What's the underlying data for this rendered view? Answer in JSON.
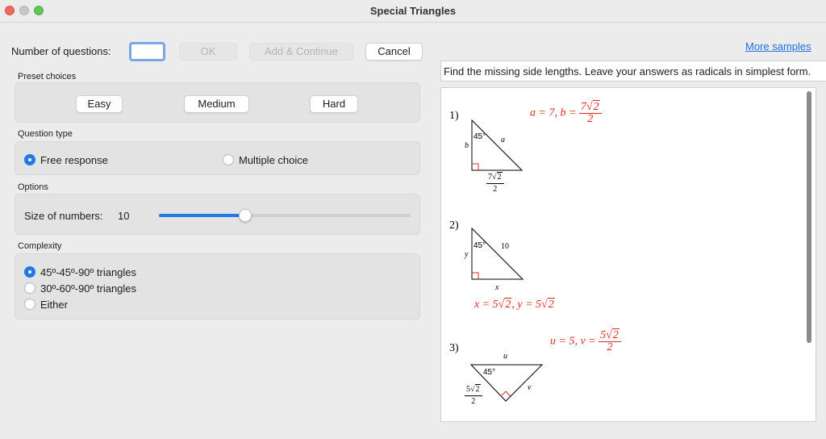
{
  "window": {
    "title": "Special Triangles"
  },
  "top_controls": {
    "number_label": "Number of questions:",
    "number_value": "",
    "ok_label": "OK",
    "add_continue_label": "Add & Continue",
    "cancel_label": "Cancel"
  },
  "preset": {
    "title": "Preset choices",
    "easy": "Easy",
    "medium": "Medium",
    "hard": "Hard"
  },
  "question_type": {
    "title": "Question type",
    "free_response": "Free response",
    "multiple_choice": "Multiple choice",
    "selected": "free_response"
  },
  "options": {
    "title": "Options",
    "size_label": "Size of numbers:",
    "size_value": "10",
    "slider_fraction": 0.34
  },
  "complexity": {
    "title": "Complexity",
    "opt1": "45º-45º-90º triangles",
    "opt2": "30º-60º-90º triangles",
    "opt3": "Either",
    "selected": "opt1"
  },
  "preview": {
    "more_samples": "More samples",
    "instructions": "Find the missing side lengths. Leave your answers as radicals in simplest form.",
    "q1": {
      "num": "1)",
      "angle": "45°",
      "leg_label": "b",
      "hyp_label": "a",
      "base_num_coef": "7",
      "base_num_rad": "2",
      "base_den": "2",
      "ans_prefix": "a = 7,  b = ",
      "ans_num_coef": "7",
      "ans_num_rad": "2",
      "ans_den": "2"
    },
    "q2": {
      "num": "2)",
      "angle": "45°",
      "leg_label": "y",
      "hyp_label": "10",
      "base_label": "x",
      "ans_text_a": "x = 5",
      "ans_rad_a": "2",
      "ans_text_b": ",  y = 5",
      "ans_rad_b": "2"
    },
    "q3": {
      "num": "3)",
      "angle": "45°",
      "top_label": "u",
      "right_label": "v",
      "left_num_coef": "5",
      "left_num_rad": "2",
      "left_den": "2",
      "ans_prefix": "u = 5,  v = ",
      "ans_num_coef": "5",
      "ans_num_rad": "2",
      "ans_den": "2"
    }
  },
  "colors": {
    "accent": "#1f7ae8",
    "answer_red": "#e0281f",
    "link": "#1f6fe0"
  }
}
